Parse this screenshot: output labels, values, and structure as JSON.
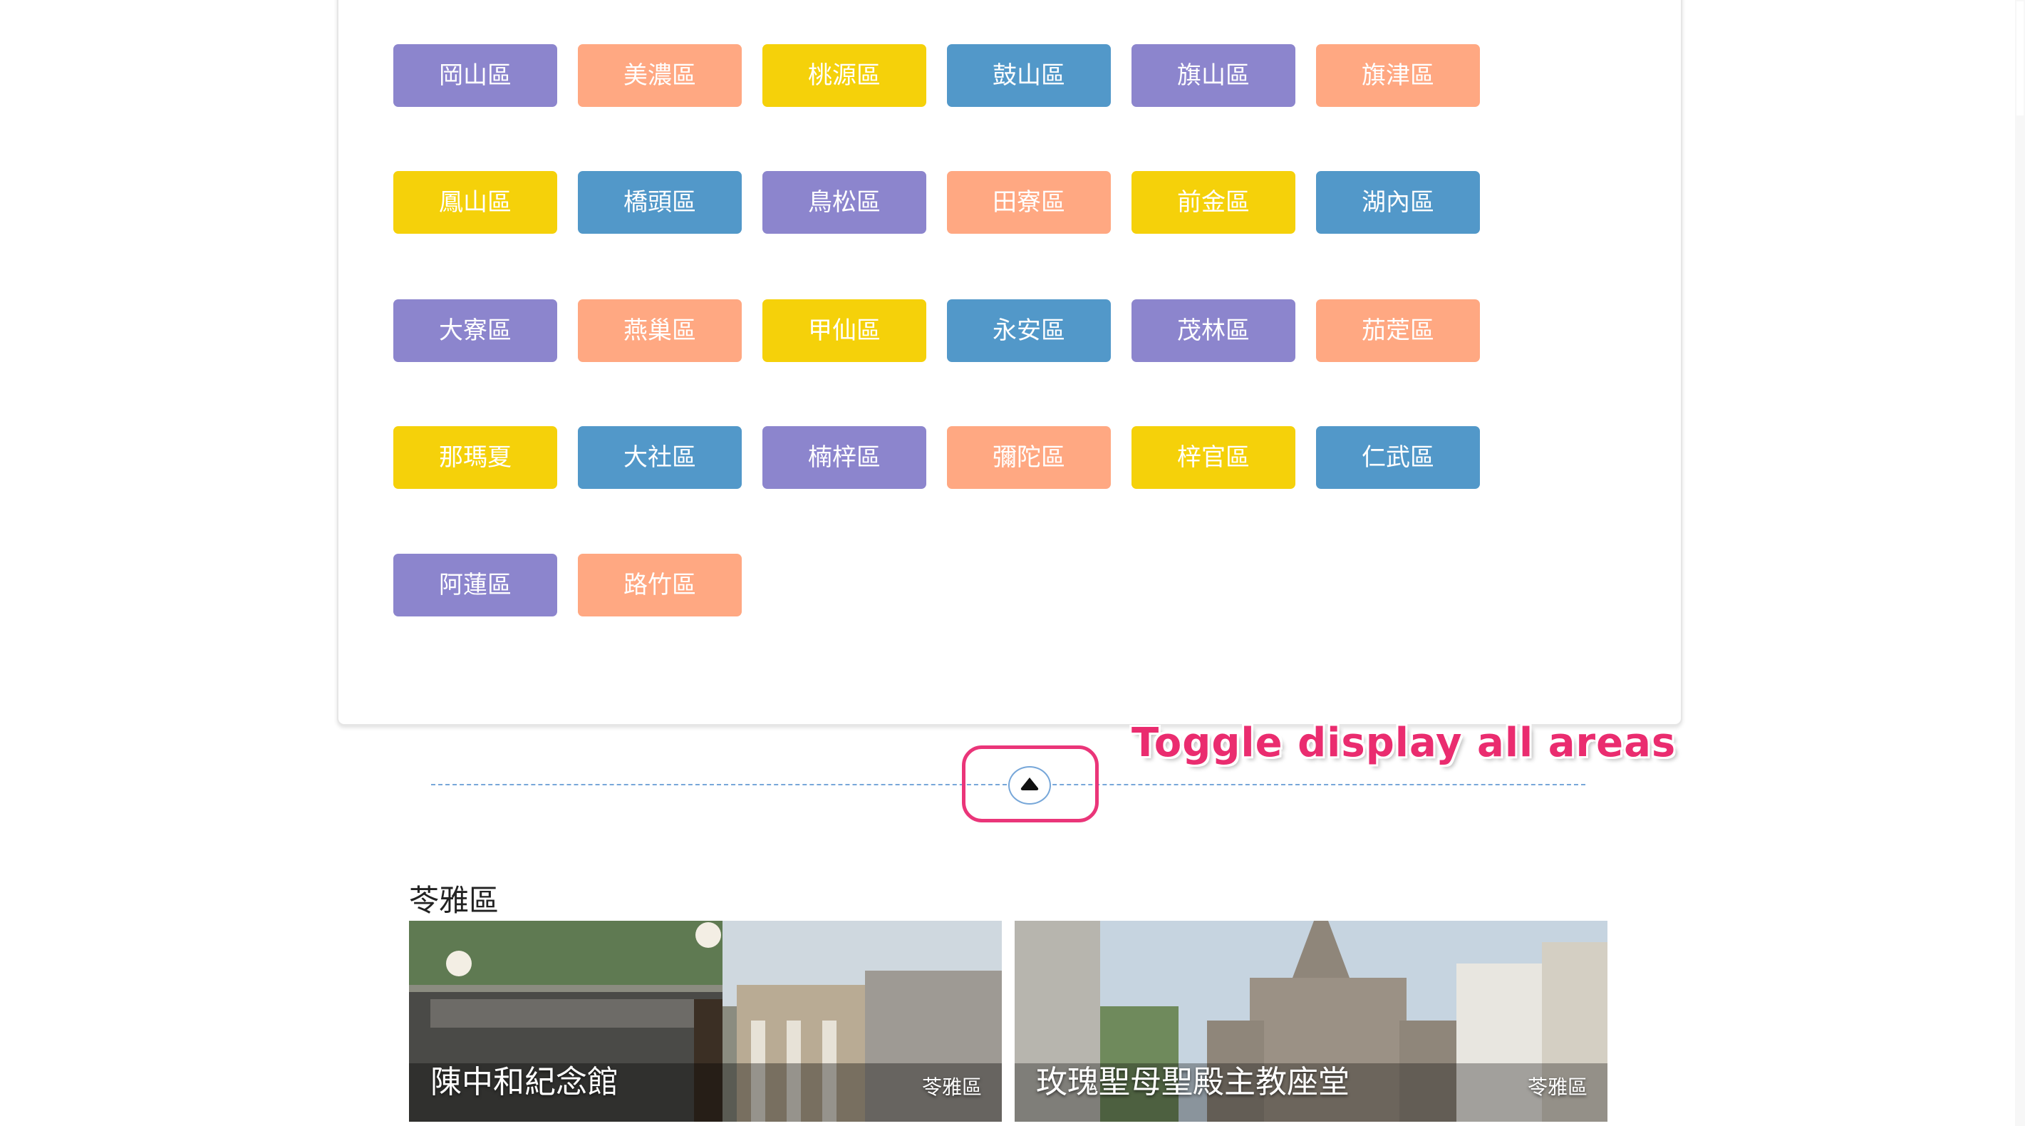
{
  "areas": [
    [
      "岡山區",
      "美濃區",
      "桃源區",
      "鼓山區",
      "旗山區",
      "旗津區"
    ],
    [
      "鳳山區",
      "橋頭區",
      "鳥松區",
      "田寮區",
      "前金區",
      "湖內區"
    ],
    [
      "大寮區",
      "燕巢區",
      "甲仙區",
      "永安區",
      "茂林區",
      "茄萣區"
    ],
    [
      "那瑪夏",
      "大社區",
      "楠梓區",
      "彌陀區",
      "梓官區",
      "仁武區"
    ],
    [
      "阿蓮區",
      "路竹區"
    ]
  ],
  "tag_colors": [
    "#8c85cd",
    "#ffa882",
    "#f5d10a",
    "#5298c9"
  ],
  "toggle": {
    "icon": "caret-up-icon"
  },
  "annotation": "Toggle display all areas",
  "section": {
    "title": "苓雅區",
    "spots": [
      {
        "name": "陳中和紀念館",
        "area": "苓雅區"
      },
      {
        "name": "玫瑰聖母聖殿主教座堂",
        "area": "苓雅區"
      }
    ]
  }
}
